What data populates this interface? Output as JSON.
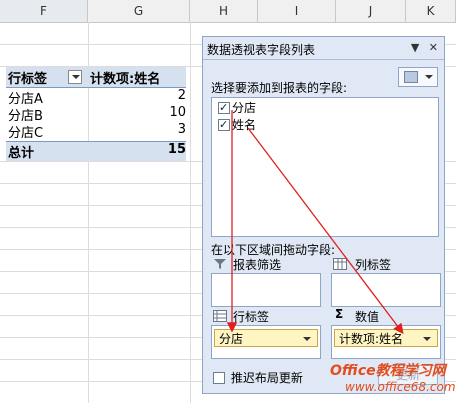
{
  "columns": [
    "F",
    "G",
    "H",
    "I",
    "J",
    "K"
  ],
  "pivot": {
    "row_label": "行标签",
    "value_label": "计数项:姓名",
    "rows": [
      {
        "name": "分店A",
        "value": "2"
      },
      {
        "name": "分店B",
        "value": "10"
      },
      {
        "name": "分店C",
        "value": "3"
      }
    ],
    "total_label": "总计",
    "total_value": "15"
  },
  "panel": {
    "title": "数据透视表字段列表",
    "controls": {
      "dropdown": "▼",
      "close": "✕"
    },
    "choose_prompt": "选择要添加到报表的字段:",
    "fields": [
      {
        "label": "分店",
        "checked": true
      },
      {
        "label": "姓名",
        "checked": true
      }
    ],
    "drag_prompt": "在以下区域间拖动字段:",
    "areas": {
      "filter": "报表筛选",
      "columns": "列标签",
      "rows": "行标签",
      "values": "数值"
    },
    "row_chip": "分店",
    "value_chip": "计数项:姓名",
    "defer_label": "推迟布局更新",
    "update_label": "更新"
  },
  "watermark": {
    "line1": "Office教程学习网",
    "line2": "www.office68.com"
  },
  "colors": {
    "panel_bg": "#dfe8f4",
    "pivot_header_bg": "#d6e1ef",
    "arrow": "#e02020",
    "chip_bg": "#fff5c2"
  }
}
